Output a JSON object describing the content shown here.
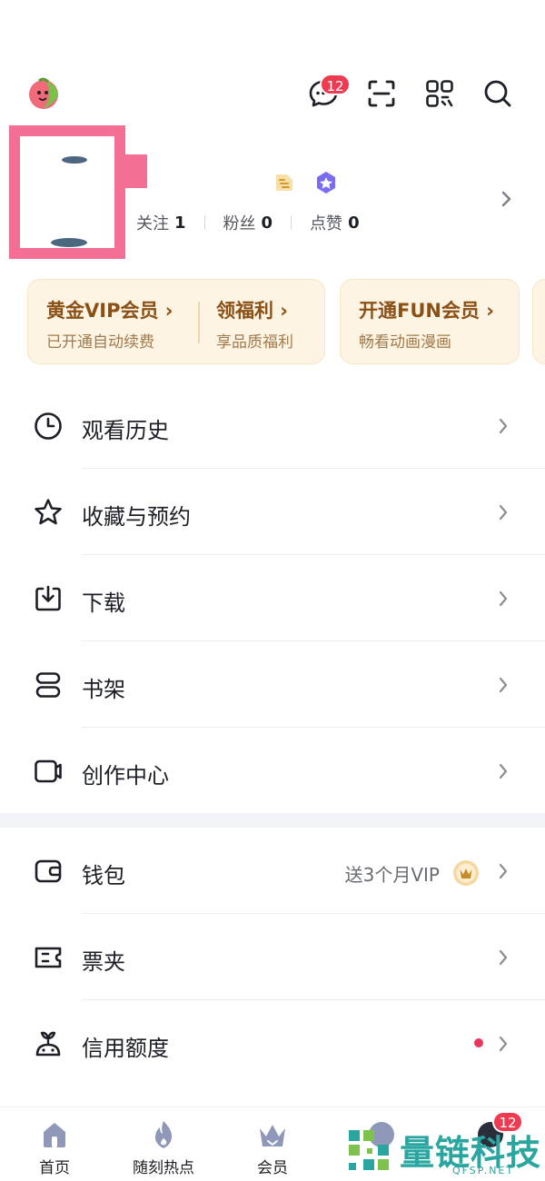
{
  "colors": {
    "accent_red": "#ef3b52",
    "gold_text": "#8a5016",
    "card_bg": "#fdf4e4",
    "pink_mask": "#f36f93"
  },
  "topbar": {
    "avatar_icon": "fruit-avatar-icon",
    "icons": [
      {
        "name": "message-icon",
        "badge": "12"
      },
      {
        "name": "scan-icon"
      },
      {
        "name": "qr-code-icon"
      },
      {
        "name": "search-icon"
      }
    ]
  },
  "profile": {
    "stats": [
      {
        "label": "关注",
        "value": "1"
      },
      {
        "label": "粉丝",
        "value": "0"
      },
      {
        "label": "点赞",
        "value": "0"
      }
    ]
  },
  "cards": {
    "gold_vip": {
      "title": "黄金VIP会员 ›",
      "subtitle": "已开通自动续费"
    },
    "welfare": {
      "title": "领福利 ›",
      "subtitle": "享品质福利"
    },
    "fun_vip": {
      "title": "开通FUN会员 ›",
      "subtitle": "畅看动画漫画"
    }
  },
  "menu": {
    "history": "观看历史",
    "favorites": "收藏与预约",
    "download": "下载",
    "bookshelf": "书架",
    "creator": "创作中心",
    "wallet": "钱包",
    "wallet_promo": "送3个月VIP",
    "tickets": "票夹",
    "credit": "信用额度"
  },
  "bottom_nav": {
    "home": "首页",
    "hot": "随刻热点",
    "vip": "会员",
    "mine_badge": "12"
  },
  "watermark": {
    "text": "量链科技",
    "sub": "QFSP.NET"
  }
}
